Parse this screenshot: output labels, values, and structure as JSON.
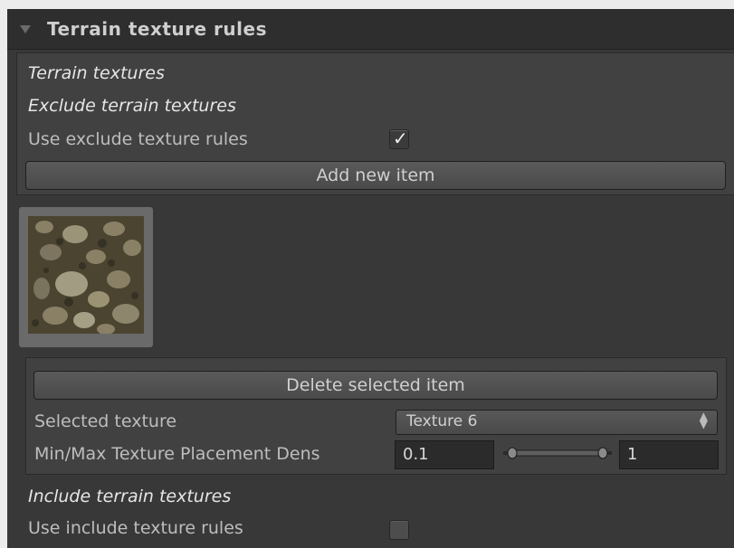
{
  "header": {
    "title": "Terrain texture rules"
  },
  "section": {
    "terrain_textures": "Terrain textures",
    "exclude_title": "Exclude terrain textures",
    "use_exclude_label": "Use exclude texture rules",
    "use_exclude_checked": true,
    "add_button": "Add new item",
    "delete_button": "Delete selected item",
    "selected_texture_label": "Selected texture",
    "selected_texture_value": "Texture 6",
    "minmax_label": "Min/Max Texture Placement Dens",
    "min_value": "0.1",
    "max_value": "1",
    "include_title": "Include terrain textures",
    "use_include_label": "Use include texture rules",
    "use_include_checked": false
  },
  "colors": {
    "panel": "#383838",
    "header": "#2e2e2e",
    "text": "#bdbdbd",
    "white_text": "#e6e6e6"
  }
}
